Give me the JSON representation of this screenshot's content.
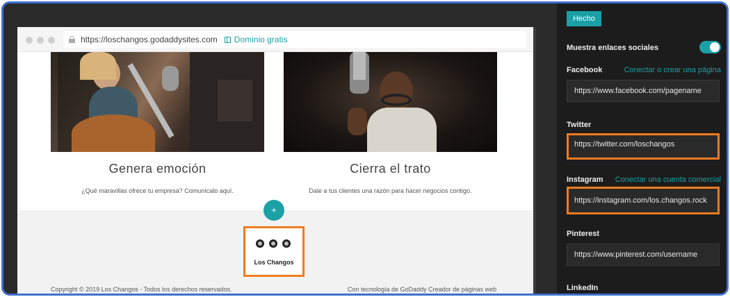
{
  "browser": {
    "url": "https://loschangos.godaddysites.com",
    "domain_link": "Dominio gratis"
  },
  "cards": [
    {
      "title": "Genera emoción",
      "description": "¿Qué maravillas ofrece tu empresa? Comunícalo aquí."
    },
    {
      "title": "Cierra el trato",
      "description": "Dale a tus clientes una razón para hacer negocios contigo."
    }
  ],
  "add_section": {
    "label": "+"
  },
  "social": {
    "icons": [
      "twitter-icon",
      "instagram-icon",
      "youtube-icon"
    ],
    "name": "Los Changos"
  },
  "footer": {
    "copyright": "Copyright © 2019 Los Changos - Todos los derechos reservados.",
    "powered": "Con tecnología de GoDaddy Creador de páginas web"
  },
  "panel": {
    "done_label": "Hecho",
    "show_social_label": "Muestra enlaces sociales",
    "show_social_enabled": true,
    "facebook": {
      "label": "Facebook",
      "link": "Conectar o crear una página",
      "value": "https://www.facebook.com/pagename"
    },
    "twitter": {
      "label": "Twitter",
      "value": "https://twitter.com/loschangos"
    },
    "instagram": {
      "label": "Instagram",
      "link": "Conectar una cuenta comercial",
      "value": "https://instagram.com/los.changos.rock"
    },
    "pinterest": {
      "label": "Pinterest",
      "value": "https://www.pinterest.com/username"
    },
    "linkedin": {
      "label": "LinkedIn"
    }
  },
  "colors": {
    "accent": "#1ba0a6",
    "highlight": "#f07c1f",
    "frame": "#3f6fcf"
  }
}
